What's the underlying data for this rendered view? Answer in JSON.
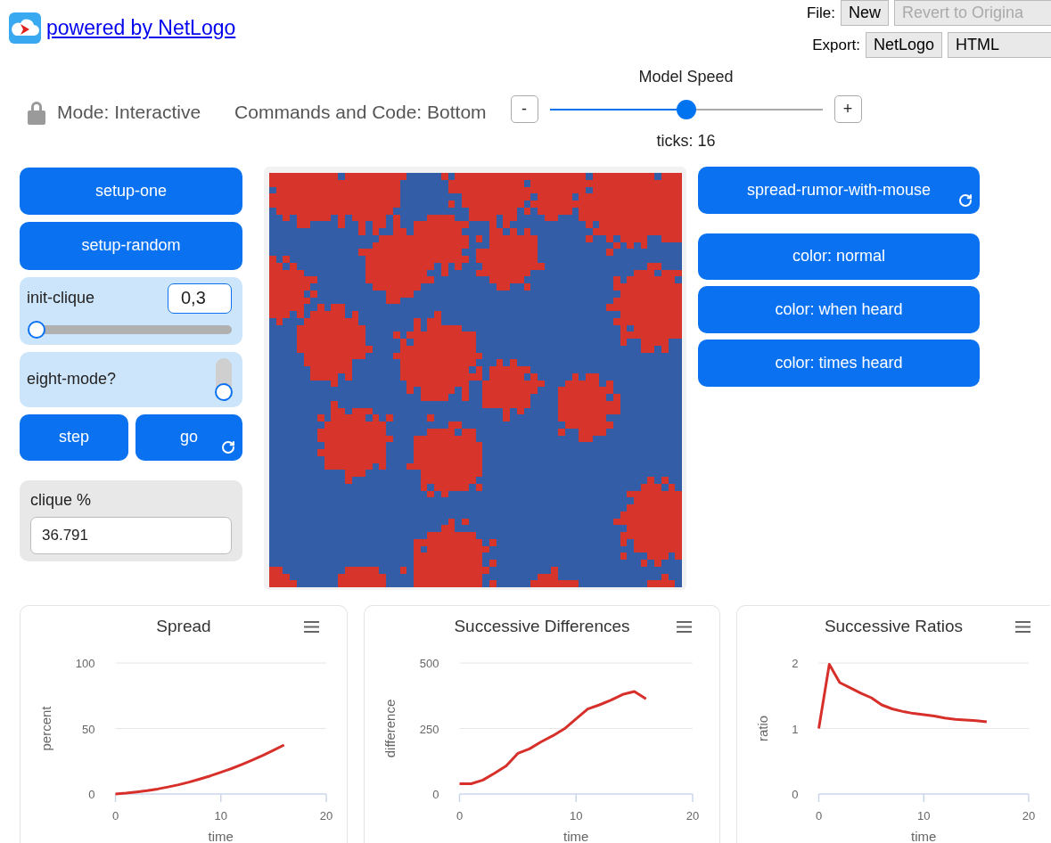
{
  "header": {
    "link": "powered by NetLogo",
    "file_menu": {
      "label": "File:",
      "buttons": [
        {
          "label": "New",
          "disabled": false
        },
        {
          "label": "Revert to Origina",
          "disabled": true
        }
      ]
    },
    "export_menu": {
      "label": "Export:",
      "buttons": [
        {
          "label": "NetLogo",
          "disabled": false
        },
        {
          "label": "HTML",
          "disabled": false
        }
      ]
    }
  },
  "controls": {
    "mode": "Mode: Interactive",
    "commands": "Commands and Code: Bottom",
    "speed": {
      "title": "Model Speed",
      "decrease": "-",
      "increase": "+",
      "level": 0.5,
      "ticks": "ticks: 16"
    }
  },
  "widgets_left": [
    {
      "kind": "button",
      "label": "setup-one",
      "forever": false
    },
    {
      "kind": "button",
      "label": "setup-random",
      "forever": false
    },
    {
      "kind": "slider",
      "label": "init-clique",
      "value": "0,3",
      "level": 0
    },
    {
      "kind": "switch",
      "label": "eight-mode?",
      "on": false
    },
    {
      "kind": "button_pair",
      "buttons": [
        {
          "label": "step",
          "forever": false
        },
        {
          "label": "go",
          "forever": true
        }
      ]
    },
    {
      "kind": "monitor",
      "label": "clique %",
      "value": "36.791"
    }
  ],
  "widgets_right": [
    {
      "kind": "button",
      "label": "spread-rumor-with-mouse",
      "forever": true
    },
    {
      "kind": "button",
      "label": "color: normal",
      "forever": false
    },
    {
      "kind": "button",
      "label": "color: when heard",
      "forever": false
    },
    {
      "kind": "button",
      "label": "color: times heard",
      "forever": false
    }
  ],
  "plots": [
    {
      "chart_data": {
        "type": "line",
        "title": "Spread",
        "xlabel": "time",
        "ylabel": "percent",
        "x": [
          0,
          1,
          2,
          3,
          4,
          5,
          6,
          7,
          8,
          9,
          10,
          11,
          12,
          13,
          14,
          15,
          16
        ],
        "series": [
          {
            "color": "#d7302b",
            "values": [
              0,
              0.6,
              1.5,
              2.5,
              3.8,
              5.4,
              7.1,
              9.1,
              11.4,
              13.8,
              16.5,
              19.4,
              22.6,
              25.9,
              29.5,
              33.4,
              37.4
            ]
          }
        ],
        "xlim": [
          0,
          20
        ],
        "ylim": [
          0,
          100
        ],
        "xticks": [
          0,
          10,
          20
        ],
        "yticks": [
          0,
          50,
          100
        ]
      }
    },
    {
      "chart_data": {
        "type": "line",
        "title": "Successive Differences",
        "xlabel": "time",
        "ylabel": "difference",
        "x": [
          0,
          1,
          2,
          3,
          4,
          5,
          6,
          7,
          8,
          9,
          10,
          11,
          12,
          13,
          14,
          15,
          16
        ],
        "series": [
          {
            "color": "#d7302b",
            "values": [
              39,
              39,
              53,
              79,
              107,
              155,
              172,
              199,
              222,
              249,
              287,
              324,
              340,
              358,
              380,
              391,
              363
            ]
          }
        ],
        "xlim": [
          0,
          20
        ],
        "ylim": [
          0,
          500
        ],
        "xticks": [
          0,
          10,
          20
        ],
        "yticks": [
          0,
          250,
          500
        ]
      }
    },
    {
      "chart_data": {
        "type": "line",
        "title": "Successive Ratios",
        "xlabel": "time",
        "ylabel": "ratio",
        "x": [
          0,
          1,
          2,
          3,
          4,
          5,
          6,
          7,
          8,
          9,
          10,
          11,
          12,
          13,
          14,
          15,
          16
        ],
        "series": [
          {
            "color": "#d7302b",
            "values": [
              1.0,
              1.98,
              1.7,
              1.62,
              1.54,
              1.47,
              1.36,
              1.3,
              1.26,
              1.23,
              1.21,
              1.19,
              1.16,
              1.14,
              1.13,
              1.12,
              1.1
            ]
          }
        ],
        "xlim": [
          0,
          20
        ],
        "ylim": [
          0,
          2
        ],
        "xticks": [
          0,
          10,
          20
        ],
        "yticks": [
          0,
          1,
          2
        ]
      }
    }
  ]
}
